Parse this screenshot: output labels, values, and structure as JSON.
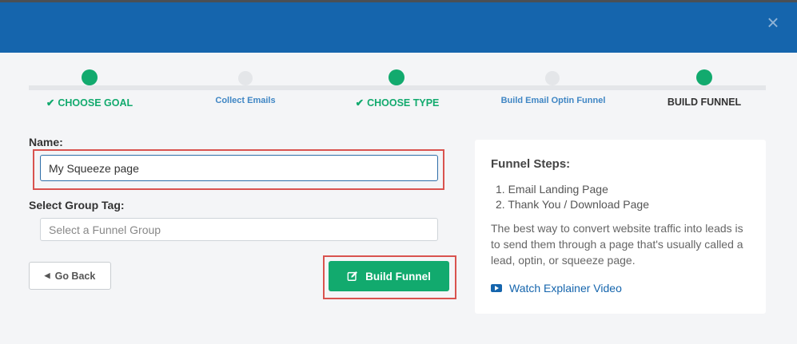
{
  "header": {
    "close_glyph": "×"
  },
  "steps": [
    {
      "label": "CHOOSE GOAL",
      "state": "done"
    },
    {
      "label": "Collect Emails",
      "state": "todo"
    },
    {
      "label": "CHOOSE TYPE",
      "state": "done"
    },
    {
      "label": "Build Email Optin Funnel",
      "state": "todo"
    },
    {
      "label": "BUILD FUNNEL",
      "state": "current"
    }
  ],
  "form": {
    "name_label": "Name:",
    "name_value": "My Squeeze page",
    "group_label": "Select Group Tag:",
    "group_placeholder": "Select a Funnel Group"
  },
  "buttons": {
    "back_label": "Go Back",
    "build_label": "Build Funnel"
  },
  "panel": {
    "title": "Funnel Steps:",
    "list": [
      "1. Email Landing Page",
      "2. Thank You / Download Page"
    ],
    "description": "The best way to convert website traffic into leads is to send them through a page that's usually called a lead, optin, or squeeze page.",
    "video_link": "Watch Explainer Video"
  },
  "colors": {
    "header": "#1565ad",
    "accent_green": "#12aa6e",
    "highlight_red": "#d9534f",
    "link_blue": "#3f86c4"
  },
  "icons": {
    "close": "close-icon",
    "check": "check-icon",
    "back": "caret-left-icon",
    "build": "edit-icon",
    "video": "video-play-icon"
  }
}
